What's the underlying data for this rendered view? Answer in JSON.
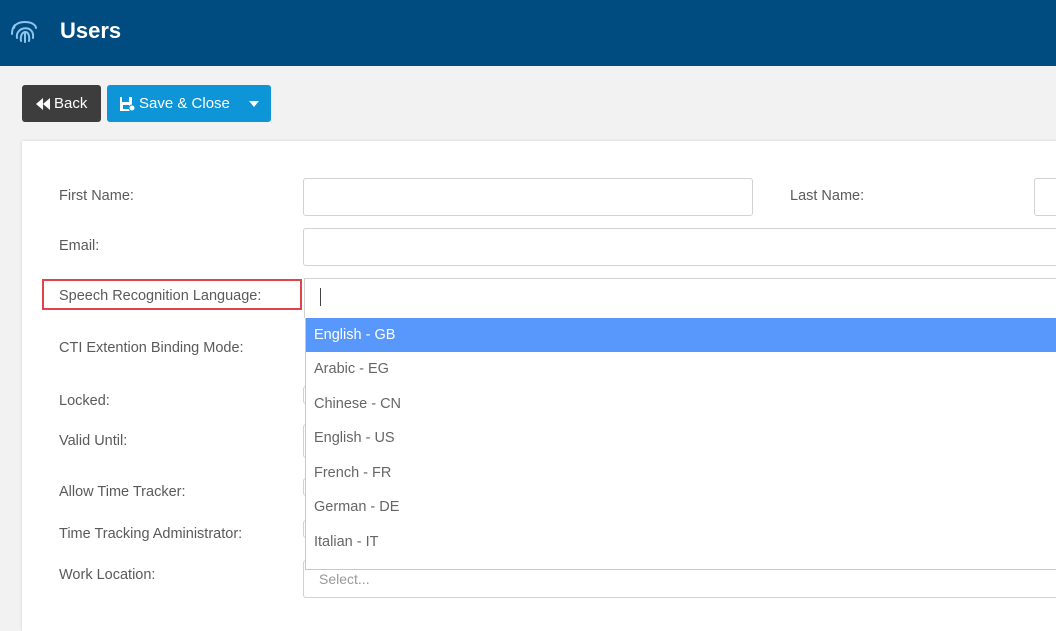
{
  "header": {
    "title": "Users",
    "logo_icon": "fingerprint-icon"
  },
  "toolbar": {
    "back_label": "Back",
    "save_label": "Save & Close",
    "back_icon": "double-left-icon",
    "save_icon": "save-icon",
    "caret_icon": "caret-down-icon"
  },
  "form": {
    "first_name_label": "First Name:",
    "last_name_label": "Last Name:",
    "email_label": "Email:",
    "speech_label": "Speech Recognition Language:",
    "cti_label": "CTI Extention Binding Mode:",
    "locked_label": "Locked:",
    "valid_until_label": "Valid Until:",
    "allow_time_tracker_label": "Allow Time Tracker:",
    "time_tracking_admin_label": "Time Tracking Administrator:",
    "work_location_label": "Work Location:",
    "work_location_placeholder": "Select..."
  },
  "speech_dropdown": {
    "options": [
      "English - GB",
      "Arabic - EG",
      "Chinese - CN",
      "English - US",
      "French - FR",
      "German - DE",
      "Italian - IT"
    ],
    "selected_index": 0
  },
  "colors": {
    "header_bg": "#004b80",
    "save_button": "#0d95d8",
    "back_button": "#3d3d3d",
    "option_highlight": "#5897fb",
    "annotation_red": "#e0444a"
  }
}
